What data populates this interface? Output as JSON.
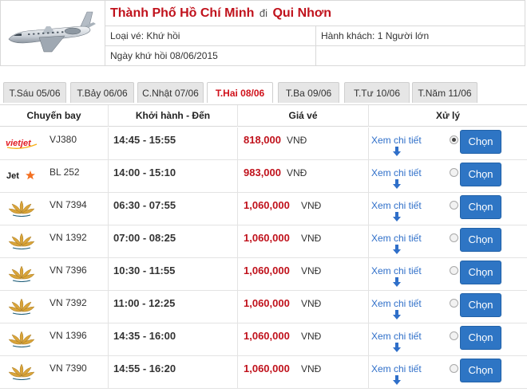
{
  "header": {
    "origin": "Thành Phố Hồ Chí Minh",
    "conj": "đi",
    "destination": "Qui Nhơn",
    "ticket_type": "Loại vé: Khứ hồi",
    "passengers": "Hành khách: 1 Người lớn",
    "return_date": "Ngày khứ hồi 08/06/2015",
    "plane_icon": "airplane-icon"
  },
  "tabs": [
    {
      "label": "T.Sáu 05/06",
      "active": false
    },
    {
      "label": "T.Bảy 06/06",
      "active": false
    },
    {
      "label": "C.Nhật 07/06",
      "active": false
    },
    {
      "label": "T.Hai 08/06",
      "active": true
    },
    {
      "label": "T.Ba 09/06",
      "active": false
    },
    {
      "label": "T.Tư 10/06",
      "active": false
    },
    {
      "label": "T.Năm 11/06",
      "active": false
    }
  ],
  "table": {
    "headers": {
      "flight": "Chuyến bay",
      "time": "Khởi hành - Đến",
      "price": "Giá vé",
      "action": "Xử lý"
    },
    "rows": [
      {
        "airline": "vietjet",
        "logo_icon": "vietjet-logo",
        "code": "VJ380",
        "time": "14:45 - 15:55",
        "price": "818,000",
        "currency": "VNĐ",
        "detail": "Xem chi tiết",
        "selected": true,
        "choose": "Chọn"
      },
      {
        "airline": "jetstar",
        "logo_icon": "jetstar-logo",
        "code": "BL 252",
        "time": "14:00 - 15:10",
        "price": "983,000",
        "currency": "VNĐ",
        "detail": "Xem chi tiết",
        "selected": false,
        "choose": "Chọn"
      },
      {
        "airline": "vietnam-airlines",
        "logo_icon": "lotus-logo",
        "code": "VN 7394",
        "time": "06:30 - 07:55",
        "price": "1,060,000",
        "currency": "VNĐ",
        "detail": "Xem chi tiết",
        "selected": false,
        "choose": "Chọn"
      },
      {
        "airline": "vietnam-airlines",
        "logo_icon": "lotus-logo",
        "code": "VN 1392",
        "time": "07:00 - 08:25",
        "price": "1,060,000",
        "currency": "VNĐ",
        "detail": "Xem chi tiết",
        "selected": false,
        "choose": "Chọn"
      },
      {
        "airline": "vietnam-airlines",
        "logo_icon": "lotus-logo",
        "code": "VN 7396",
        "time": "10:30 - 11:55",
        "price": "1,060,000",
        "currency": "VNĐ",
        "detail": "Xem chi tiết",
        "selected": false,
        "choose": "Chọn"
      },
      {
        "airline": "vietnam-airlines",
        "logo_icon": "lotus-logo",
        "code": "VN 7392",
        "time": "11:00 - 12:25",
        "price": "1,060,000",
        "currency": "VNĐ",
        "detail": "Xem chi tiết",
        "selected": false,
        "choose": "Chọn"
      },
      {
        "airline": "vietnam-airlines",
        "logo_icon": "lotus-logo",
        "code": "VN 1396",
        "time": "14:35 - 16:00",
        "price": "1,060,000",
        "currency": "VNĐ",
        "detail": "Xem chi tiết",
        "selected": false,
        "choose": "Chọn"
      },
      {
        "airline": "vietnam-airlines",
        "logo_icon": "lotus-logo",
        "code": "VN 7390",
        "time": "14:55 - 16:20",
        "price": "1,060,000",
        "currency": "VNĐ",
        "detail": "Xem chi tiết",
        "selected": false,
        "choose": "Chọn"
      }
    ]
  },
  "colors": {
    "route_red": "#c0121c",
    "active_tab_red": "#d0121b",
    "link_blue": "#2f6fc9",
    "button_blue": "#2e75c4",
    "vietjet_red": "#e21b23",
    "jetstar_orange": "#f37021",
    "lotus_gold": "#d9a43a"
  }
}
